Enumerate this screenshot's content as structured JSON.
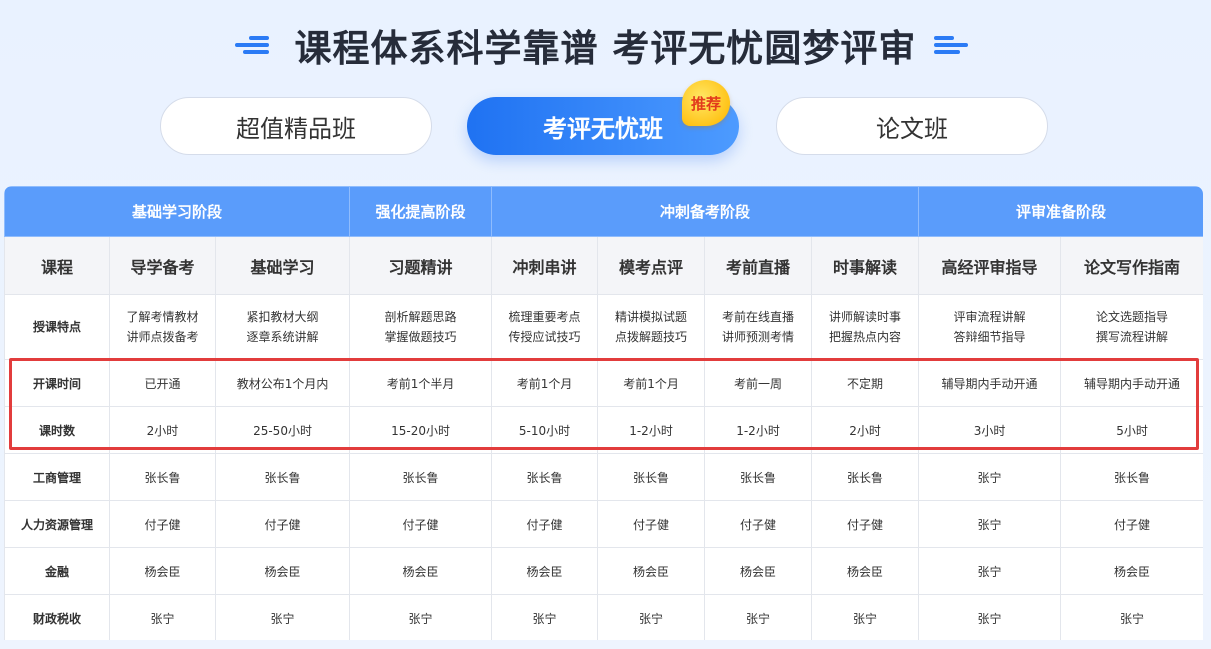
{
  "heading": {
    "title": "课程体系科学靠谱 考评无忧圆梦评审"
  },
  "tabs": [
    {
      "label": "超值精品班"
    },
    {
      "label": "考评无忧班"
    },
    {
      "label": "论文班"
    }
  ],
  "badge": "推荐",
  "table": {
    "stages": [
      "基础学习阶段",
      "强化提高阶段",
      "冲刺备考阶段",
      "评审准备阶段"
    ],
    "course_label": "课程",
    "courses": [
      "导学备考",
      "基础学习",
      "习题精讲",
      "冲刺串讲",
      "模考点评",
      "考前直播",
      "时事解读",
      "高经评审指导",
      "论文写作指南"
    ],
    "features": {
      "label": "授课特点",
      "cells": [
        [
          "了解考情教材",
          "讲师点拨备考"
        ],
        [
          "紧扣教材大纲",
          "逐章系统讲解"
        ],
        [
          "剖析解题思路",
          "掌握做题技巧"
        ],
        [
          "梳理重要考点",
          "传授应试技巧"
        ],
        [
          "精讲模拟试题",
          "点拨解题技巧"
        ],
        [
          "考前在线直播",
          "讲师预测考情"
        ],
        [
          "讲师解读时事",
          "把握热点内容"
        ],
        [
          "评审流程讲解",
          "答辩细节指导"
        ],
        [
          "论文选题指导",
          "撰写流程讲解"
        ]
      ]
    },
    "rows": [
      {
        "label": "开课时间",
        "cells": [
          "已开通",
          "教材公布1个月内",
          "考前1个半月",
          "考前1个月",
          "考前1个月",
          "考前一周",
          "不定期",
          "辅导期内手动开通",
          "辅导期内手动开通"
        ]
      },
      {
        "label": "课时数",
        "cells": [
          "2小时",
          "25-50小时",
          "15-20小时",
          "5-10小时",
          "1-2小时",
          "1-2小时",
          "2小时",
          "3小时",
          "5小时"
        ]
      },
      {
        "label": "工商管理",
        "cells": [
          "张长鲁",
          "张长鲁",
          "张长鲁",
          "张长鲁",
          "张长鲁",
          "张长鲁",
          "张长鲁",
          "张宁",
          "张长鲁"
        ]
      },
      {
        "label": "人力资源管理",
        "cells": [
          "付子健",
          "付子健",
          "付子健",
          "付子健",
          "付子健",
          "付子健",
          "付子健",
          "张宁",
          "付子健"
        ]
      },
      {
        "label": "金融",
        "cells": [
          "杨会臣",
          "杨会臣",
          "杨会臣",
          "杨会臣",
          "杨会臣",
          "杨会臣",
          "杨会臣",
          "张宁",
          "杨会臣"
        ]
      },
      {
        "label": "财政税收",
        "cells": [
          "张宁",
          "张宁",
          "张宁",
          "张宁",
          "张宁",
          "张宁",
          "张宁",
          "张宁",
          "张宁"
        ]
      }
    ]
  },
  "colors": {
    "accent": "#2b7bf5",
    "stage_header": "#5a9cfb",
    "highlight": "#e23c3c",
    "badge": "#ffc41a"
  }
}
